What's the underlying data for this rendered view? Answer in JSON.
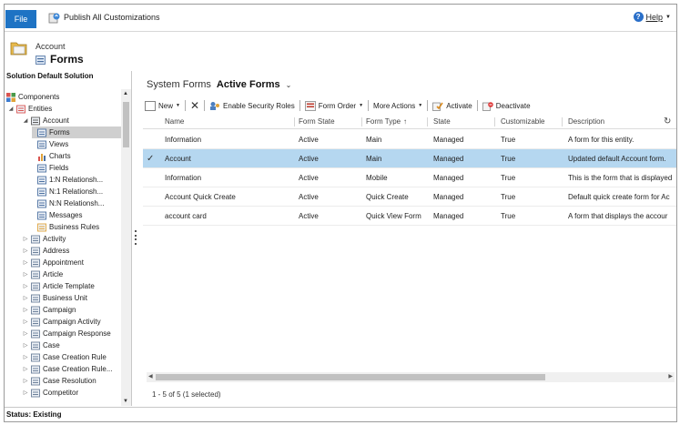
{
  "topbar": {
    "file_label": "File",
    "publish_label": "Publish All Customizations",
    "help_label": "Help"
  },
  "header": {
    "entity": "Account",
    "page": "Forms"
  },
  "sidebar": {
    "title": "Solution Default Solution",
    "items": [
      {
        "label": "Components",
        "icon": "components-icon"
      },
      {
        "label": "Entities",
        "icon": "entities-icon"
      },
      {
        "label": "Account",
        "icon": "account-icon"
      },
      {
        "label": "Forms",
        "icon": "forms-icon"
      },
      {
        "label": "Views",
        "icon": "views-icon"
      },
      {
        "label": "Charts",
        "icon": "charts-icon"
      },
      {
        "label": "Fields",
        "icon": "fields-icon"
      },
      {
        "label": "1:N Relationsh...",
        "icon": "relationship-icon"
      },
      {
        "label": "N:1 Relationsh...",
        "icon": "relationship-icon"
      },
      {
        "label": "N:N Relationsh...",
        "icon": "relationship-icon"
      },
      {
        "label": "Messages",
        "icon": "messages-icon"
      },
      {
        "label": "Business Rules",
        "icon": "business-rules-icon"
      },
      {
        "label": "Activity",
        "icon": "activity-icon"
      },
      {
        "label": "Address",
        "icon": "address-icon"
      },
      {
        "label": "Appointment",
        "icon": "appointment-icon"
      },
      {
        "label": "Article",
        "icon": "article-icon"
      },
      {
        "label": "Article Template",
        "icon": "article-template-icon"
      },
      {
        "label": "Business Unit",
        "icon": "business-unit-icon"
      },
      {
        "label": "Campaign",
        "icon": "campaign-icon"
      },
      {
        "label": "Campaign Activity",
        "icon": "campaign-activity-icon"
      },
      {
        "label": "Campaign Response",
        "icon": "campaign-response-icon"
      },
      {
        "label": "Case",
        "icon": "case-icon"
      },
      {
        "label": "Case Creation Rule",
        "icon": "case-creation-rule-icon"
      },
      {
        "label": "Case Creation Rule...",
        "icon": "case-creation-rule-icon"
      },
      {
        "label": "Case Resolution",
        "icon": "case-resolution-icon"
      },
      {
        "label": "Competitor",
        "icon": "competitor-icon"
      }
    ]
  },
  "main": {
    "view_prefix": "System Forms",
    "view_name": "Active Forms",
    "toolbar": {
      "new_label": "New",
      "security_label": "Enable Security Roles",
      "form_order_label": "Form Order",
      "more_actions_label": "More Actions",
      "activate_label": "Activate",
      "deactivate_label": "Deactivate"
    },
    "columns": [
      "Name",
      "Form State",
      "Form Type",
      "State",
      "Customizable",
      "Description"
    ],
    "sort_indicator": "↑",
    "rows": [
      {
        "name": "Information",
        "form_state": "Active",
        "form_type": "Main",
        "state": "Managed",
        "customizable": "True",
        "description": "A form for this entity."
      },
      {
        "name": "Account",
        "form_state": "Active",
        "form_type": "Main",
        "state": "Managed",
        "customizable": "True",
        "description": "Updated default Account form."
      },
      {
        "name": "Information",
        "form_state": "Active",
        "form_type": "Mobile",
        "state": "Managed",
        "customizable": "True",
        "description": "This is the form that is displayed"
      },
      {
        "name": "Account Quick Create",
        "form_state": "Active",
        "form_type": "Quick Create",
        "state": "Managed",
        "customizable": "True",
        "description": "Default quick create form for Ac"
      },
      {
        "name": "account card",
        "form_state": "Active",
        "form_type": "Quick View Form",
        "state": "Managed",
        "customizable": "True",
        "description": "A form that displays the accour"
      }
    ],
    "selected_row": 1,
    "record_count": "1 - 5 of 5 (1 selected)"
  },
  "status": {
    "text": "Status: Existing"
  },
  "colors": {
    "file_blue": "#1e73c4",
    "selected_row": "#b5d7f0",
    "selected_tree": "#cfcfcf"
  }
}
